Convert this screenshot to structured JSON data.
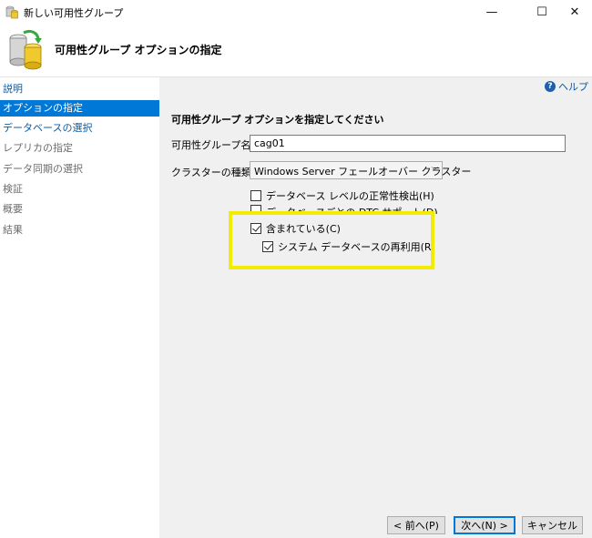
{
  "window": {
    "title": "新しい可用性グループ",
    "controls": {
      "minimize": "—",
      "maximize": "☐",
      "close": "✕"
    }
  },
  "header": {
    "title": "可用性グループ オプションの指定"
  },
  "sidebar": {
    "items": [
      {
        "label": "説明",
        "state": "link"
      },
      {
        "label": "オプションの指定",
        "state": "selected"
      },
      {
        "label": "データベースの選択",
        "state": "link"
      },
      {
        "label": "レプリカの指定",
        "state": "disabled"
      },
      {
        "label": "データ同期の選択",
        "state": "disabled"
      },
      {
        "label": "検証",
        "state": "disabled"
      },
      {
        "label": "概要",
        "state": "disabled"
      },
      {
        "label": "結果",
        "state": "disabled"
      }
    ]
  },
  "main": {
    "help": "ヘルプ",
    "section_title": "可用性グループ オプションを指定してください",
    "name_label": "可用性グループ名(A):",
    "name_value": "cag01",
    "cluster_label": "クラスターの種類(T):",
    "cluster_value": "Windows Server フェールオーバー クラスター",
    "checkboxes": [
      {
        "label": "データベース レベルの正常性検出(H)",
        "checked": false
      },
      {
        "label": "データベースごとの DTC サポート(D)",
        "checked": false
      },
      {
        "label": "含まれている(C)",
        "checked": true
      },
      {
        "label": "システム データベースの再利用(R)",
        "checked": true
      }
    ]
  },
  "footer": {
    "prev": "< 前へ(P)",
    "next": "次へ(N) >",
    "cancel": "キャンセル"
  },
  "colors": {
    "accent": "#0078d7",
    "highlight": "#f3ec00",
    "link": "#0b5ca8"
  }
}
